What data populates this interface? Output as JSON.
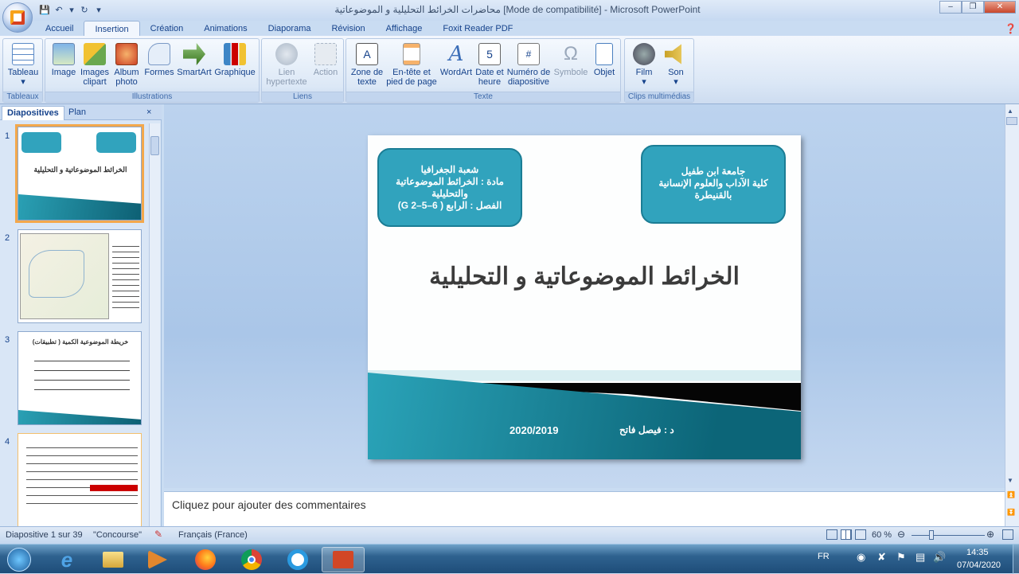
{
  "window": {
    "title": "محاضرات الخرائط التحليلية و الموضوعاتية [Mode de compatibilité] - Microsoft PowerPoint",
    "minimize": "–",
    "maximize": "❐",
    "close": "✕"
  },
  "ribbon_tabs": [
    "Accueil",
    "Insertion",
    "Création",
    "Animations",
    "Diaporama",
    "Révision",
    "Affichage",
    "Foxit Reader PDF"
  ],
  "groups": {
    "tableaux": "Tableaux",
    "illustrations": "Illustrations",
    "liens": "Liens",
    "texte": "Texte",
    "clips": "Clips multimédias"
  },
  "buttons": {
    "tableau": "Tableau",
    "image": "Image",
    "images_clipart": "Images clipart",
    "album": "Album photo",
    "formes": "Formes",
    "smartart": "SmartArt",
    "graphique": "Graphique",
    "lien": "Lien hypertexte",
    "action": "Action",
    "zone": "Zone de texte",
    "entete": "En-tête et pied de page",
    "wordart": "WordArt",
    "date": "Date et heure",
    "numero": "Numéro de diapositive",
    "symbole": "Symbole",
    "objet": "Objet",
    "film": "Film",
    "son": "Son"
  },
  "panel": {
    "tab_slides": "Diapositives",
    "tab_plan": "Plan",
    "close": "×"
  },
  "thumbs": {
    "n1": "1",
    "n2": "2",
    "n3": "3",
    "n4": "4",
    "t1": "الخرائط الموضوعاتية و التحليلية",
    "t3": "خريطة الموضوعية الكمية ( تطبيقات)"
  },
  "slide": {
    "box_left": {
      "l1": "شعبة الجغرافيا",
      "l2": "مادة : الخرائط الموضوعاتية والتحليلية",
      "l3": "الفصل : الرابع ( G 2–5–6)"
    },
    "box_right": {
      "l1": "جامعة ابن طفيل",
      "l2": "كلية الآداب والعلوم الإنسانية",
      "l3": "بالقنيطرة"
    },
    "title": "الخرائط الموضوعاتية و التحليلية",
    "year": "2020/2019",
    "author": "د : فيصل فاتح"
  },
  "notes_placeholder": "Cliquez pour ajouter des commentaires",
  "status": {
    "slide": "Diapositive 1 sur 39",
    "theme": "\"Concourse\"",
    "lang": "Français (France)",
    "zoom": "60 %"
  },
  "taskbar": {
    "lang": "FR",
    "time": "14:35",
    "date": "07/04/2020"
  }
}
